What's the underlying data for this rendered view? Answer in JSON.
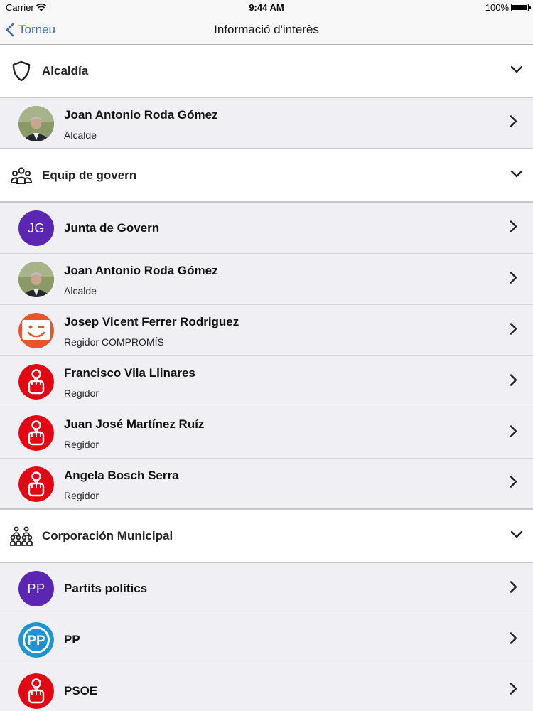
{
  "status_bar": {
    "carrier": "Carrier",
    "time": "9:44 AM",
    "battery": "100%"
  },
  "nav": {
    "back_label": "Torneu",
    "title": "Informació d'interès"
  },
  "sections": [
    {
      "title": "Alcaldía",
      "icon": "shield-icon",
      "rows": [
        {
          "name": "Joan Antonio Roda Gómez",
          "role": "Alcalde",
          "avatar": "photo"
        }
      ]
    },
    {
      "title": "Equip de govern",
      "icon": "group-icon",
      "rows": [
        {
          "name": "Junta de Govern",
          "avatar": "initials",
          "initials": "JG"
        },
        {
          "name": "Joan Antonio Roda Gómez",
          "role": "Alcalde",
          "avatar": "photo"
        },
        {
          "name": "Josep Vicent Ferrer Rodriguez",
          "role": "Regidor COMPROMÍS",
          "avatar": "compromis-logo"
        },
        {
          "name": "Francisco Vila Llinares",
          "role": "Regidor",
          "avatar": "psoe-logo"
        },
        {
          "name": "Juan José Martínez Ruíz",
          "role": "Regidor",
          "avatar": "psoe-logo"
        },
        {
          "name": "Angela Bosch Serra",
          "role": "Regidor",
          "avatar": "psoe-logo"
        }
      ]
    },
    {
      "title": "Corporación Municipal",
      "icon": "crowd-icon",
      "rows": [
        {
          "name": "Partits polítics",
          "avatar": "initials",
          "initials": "PP"
        },
        {
          "name": "PP",
          "avatar": "pp-logo",
          "logo_text": "PP"
        },
        {
          "name": "PSOE",
          "avatar": "psoe-logo"
        }
      ]
    }
  ],
  "colors": {
    "accent": "#3f6fb1",
    "initials_bg": "#5a26b3",
    "psoe_red": "#e30613",
    "compromis_orange": "#e8542c",
    "pp_blue": "#1e94d2"
  }
}
